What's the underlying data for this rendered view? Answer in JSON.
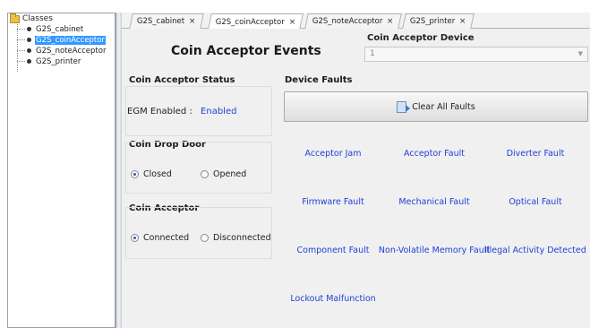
{
  "tree": {
    "root_label": "Classes",
    "items": [
      {
        "label": "G2S_cabinet",
        "selected": false
      },
      {
        "label": "G2S_coinAcceptor",
        "selected": true
      },
      {
        "label": "G2S_noteAcceptor",
        "selected": false
      },
      {
        "label": "G2S_printer",
        "selected": false
      }
    ]
  },
  "tabs": [
    {
      "label": "G2S_cabinet",
      "close": "×",
      "active": false
    },
    {
      "label": "G2S_coinAcceptor",
      "close": "×",
      "active": true
    },
    {
      "label": "G2S_noteAcceptor",
      "close": "×",
      "active": false
    },
    {
      "label": "G2S_printer",
      "close": "×",
      "active": false
    }
  ],
  "page": {
    "title": "Coin Acceptor Events",
    "device_label": "Coin Acceptor Device",
    "device_value": "1"
  },
  "status": {
    "title": "Coin Acceptor Status",
    "egm_label": "EGM Enabled :",
    "egm_value": "Enabled"
  },
  "coin_drop_door": {
    "title": "Coin Drop Door",
    "options": [
      "Closed",
      "Opened"
    ],
    "selected": "Closed"
  },
  "coin_acceptor": {
    "title": "Coin Acceptor",
    "options": [
      "Connected",
      "Disconnected"
    ],
    "selected": "Connected"
  },
  "faults": {
    "title": "Device Faults",
    "clear_label": "Clear All Faults",
    "items": [
      "Acceptor Jam",
      "Acceptor Fault",
      "Diverter Fault",
      "Firmware Fault",
      "Mechanical Fault",
      "Optical Fault",
      "Component Fault",
      "Non-Volatile Memory Fault",
      "Illegal Activity Detected",
      "Lockout Malfunction"
    ]
  },
  "colors": {
    "link_blue": "#1f3fd6",
    "selection": "#3399ff",
    "folder": "#e9c24c"
  }
}
